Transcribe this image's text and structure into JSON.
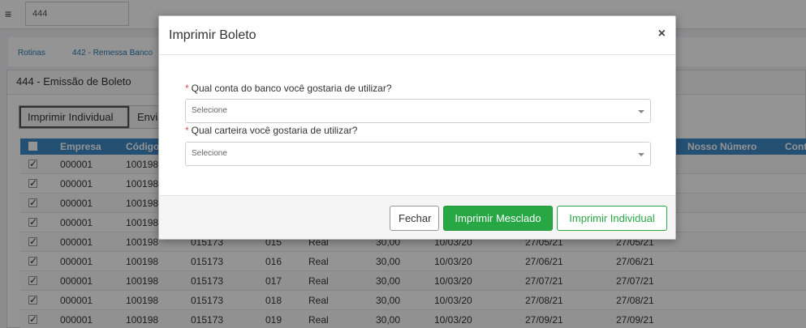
{
  "topbar": {
    "menu_icon": "≡",
    "search_value": "444"
  },
  "breadcrumb": {
    "items": [
      "Rotinas",
      "442 - Remessa Banco"
    ]
  },
  "panel": {
    "title": "444 - Emissão de Boleto",
    "btn_individual": "Imprimir Individual",
    "btn_enviar": "Enviar"
  },
  "grid": {
    "headers": [
      "Empresa",
      "Código",
      "Nosso Número",
      "Conta"
    ],
    "rows": [
      [
        "000001",
        "100198",
        "",
        "",
        "",
        "",
        "",
        ""
      ],
      [
        "000001",
        "100198",
        "",
        "",
        "",
        "",
        "",
        ""
      ],
      [
        "000001",
        "100198",
        "",
        "",
        "",
        "",
        "",
        ""
      ],
      [
        "000001",
        "100198",
        "",
        "",
        "",
        "",
        "",
        ""
      ],
      [
        "000001",
        "100198",
        "015173",
        "015",
        "Real",
        "30,00",
        "10/03/20",
        "27/05/21",
        "27/05/21"
      ],
      [
        "000001",
        "100198",
        "015173",
        "016",
        "Real",
        "30,00",
        "10/03/20",
        "27/06/21",
        "27/06/21"
      ],
      [
        "000001",
        "100198",
        "015173",
        "017",
        "Real",
        "30,00",
        "10/03/20",
        "27/07/21",
        "27/07/21"
      ],
      [
        "000001",
        "100198",
        "015173",
        "018",
        "Real",
        "30,00",
        "10/03/20",
        "27/08/21",
        "27/08/21"
      ],
      [
        "000001",
        "100198",
        "015173",
        "019",
        "Real",
        "30,00",
        "10/03/20",
        "27/09/21",
        "27/09/21"
      ]
    ]
  },
  "modal": {
    "title": "Imprimir Boleto",
    "close_icon": "×",
    "required_mark": "*",
    "q1_label": "Qual conta do banco você gostaria de utilizar?",
    "q1_value": "Selecione",
    "q2_label": "Qual carteira você gostaria de utilizar?",
    "q2_value": "Selecione",
    "btn_fechar": "Fechar",
    "btn_mesclado": "Imprimir Mesclado",
    "btn_individual": "Imprimir Individual"
  },
  "colors": {
    "primary_green": "#28a745",
    "grid_header": "#3e8bc9",
    "required": "#d9534f"
  }
}
